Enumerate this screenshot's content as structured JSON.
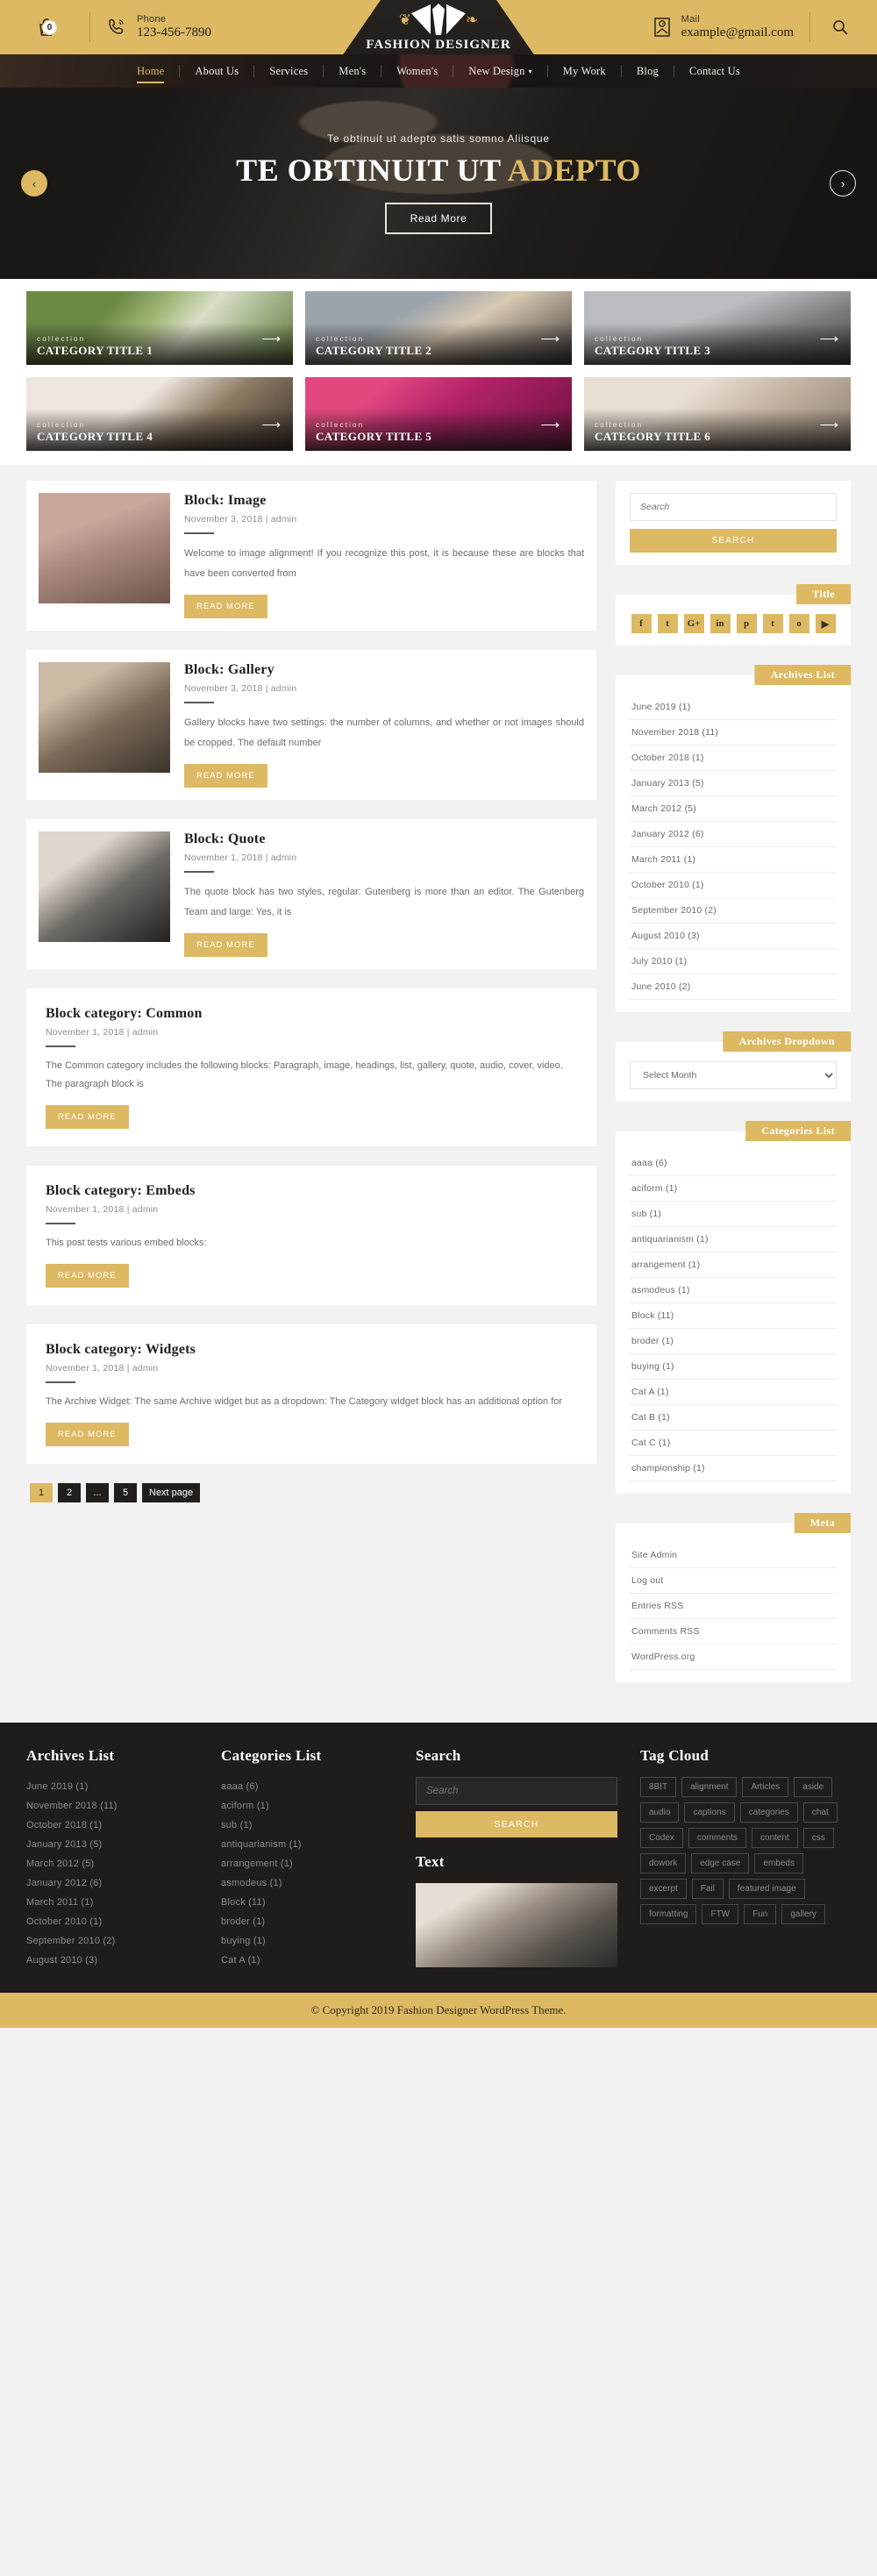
{
  "header": {
    "cart_count": "0",
    "phone_label": "Phone",
    "phone_value": "123-456-7890",
    "mail_label": "Mail",
    "mail_value": "example@gmail.com",
    "logo_text": "FASHION DESIGNER"
  },
  "nav": {
    "items": [
      {
        "label": "Home",
        "active": true,
        "dropdown": false
      },
      {
        "label": "About Us",
        "active": false,
        "dropdown": false
      },
      {
        "label": "Services",
        "active": false,
        "dropdown": false
      },
      {
        "label": "Men's",
        "active": false,
        "dropdown": false
      },
      {
        "label": "Women's",
        "active": false,
        "dropdown": false
      },
      {
        "label": "New Design",
        "active": false,
        "dropdown": true
      },
      {
        "label": "My Work",
        "active": false,
        "dropdown": false
      },
      {
        "label": "Blog",
        "active": false,
        "dropdown": false
      },
      {
        "label": "Contact Us",
        "active": false,
        "dropdown": false
      }
    ]
  },
  "hero": {
    "subtitle": "Te obtinuit ut adepto satis somno Aliisque",
    "title_white": "TE OBTINUIT UT ",
    "title_gold": "ADEPTO",
    "button": "Read More",
    "prev": "‹",
    "next": "›"
  },
  "categories": [
    {
      "kicker": "collection",
      "title": "CATEGORY TITLE 1"
    },
    {
      "kicker": "collection",
      "title": "CATEGORY TITLE 2"
    },
    {
      "kicker": "collection",
      "title": "CATEGORY TITLE 3"
    },
    {
      "kicker": "collection",
      "title": "CATEGORY TITLE 4"
    },
    {
      "kicker": "collection",
      "title": "CATEGORY TITLE 5"
    },
    {
      "kicker": "collection",
      "title": "CATEGORY TITLE 6"
    }
  ],
  "posts": [
    {
      "title": "Block: Image",
      "meta": "November 3, 2018 |  admin",
      "excerpt": "Welcome to image alignment! If you recognize this post, it is because these are blocks that have been converted from",
      "read_more": "READ MORE"
    },
    {
      "title": "Block: Gallery",
      "meta": "November 3, 2018 |  admin",
      "excerpt": "Gallery blocks have two settings: the number of columns, and whether or not images should be cropped. The default number",
      "read_more": "READ MORE"
    },
    {
      "title": "Block: Quote",
      "meta": "November 1, 2018 |  admin",
      "excerpt": "The quote block has two styles, regular: Gutenberg is more than an editor. The Gutenberg Team and large: Yes, it is",
      "read_more": "READ MORE"
    }
  ],
  "wide_posts": [
    {
      "title": "Block category: Common",
      "meta": "November 1, 2018 |  admin",
      "excerpt": "The Common category includes the following blocks: Paragraph, image, headings, list, gallery, quote, audio, cover, video. The paragraph block is",
      "read_more": "READ MORE"
    },
    {
      "title": "Block category: Embeds",
      "meta": "November 1, 2018 |  admin",
      "excerpt": "This post tests various embed blocks:",
      "read_more": "READ MORE"
    },
    {
      "title": "Block category: Widgets",
      "meta": "November 1, 2018 |  admin",
      "excerpt": "The Archive Widget: The same Archive widget but as a dropdown: The Category widget block has an additional option for",
      "read_more": "READ MORE"
    }
  ],
  "pagination": [
    {
      "label": "1",
      "active": true
    },
    {
      "label": "2",
      "active": false
    },
    {
      "label": "...",
      "active": false
    },
    {
      "label": "5",
      "active": false
    },
    {
      "label": "Next page",
      "active": false
    }
  ],
  "sidebar": {
    "search": {
      "placeholder": "Search",
      "button": "SEARCH"
    },
    "social": {
      "title": "Title",
      "items": [
        {
          "name": "facebook",
          "glyph": "f"
        },
        {
          "name": "twitter",
          "glyph": "t"
        },
        {
          "name": "google-plus",
          "glyph": "G+"
        },
        {
          "name": "linkedin",
          "glyph": "in"
        },
        {
          "name": "pinterest",
          "glyph": "p"
        },
        {
          "name": "tumblr",
          "glyph": "t"
        },
        {
          "name": "instagram",
          "glyph": "o"
        },
        {
          "name": "youtube",
          "glyph": "▶"
        }
      ]
    },
    "archives_list": {
      "title": "Archives List",
      "items": [
        "June 2019 (1)",
        "November 2018 (11)",
        "October 2018 (1)",
        "January 2013 (5)",
        "March 2012 (5)",
        "January 2012 (6)",
        "March 2011 (1)",
        "October 2010 (1)",
        "September 2010 (2)",
        "August 2010 (3)",
        "July 2010 (1)",
        "June 2010 (2)"
      ]
    },
    "archives_dropdown": {
      "title": "Archives Dropdown",
      "selected": "Select Month"
    },
    "categories_list": {
      "title": "Categories List",
      "items": [
        "aaaa (6)",
        "aciform (1)",
        "sub (1)",
        "antiquarianism (1)",
        "arrangement (1)",
        "asmodeus (1)",
        "Block (11)",
        "broder (1)",
        "buying (1)",
        "Cat A (1)",
        "Cat B (1)",
        "Cat C (1)",
        "championship (1)"
      ]
    },
    "meta": {
      "title": "Meta",
      "items": [
        "Site Admin",
        "Log out",
        "Entries RSS",
        "Comments RSS",
        "WordPress.org"
      ]
    }
  },
  "footer": {
    "archives": {
      "title": "Archives List",
      "items": [
        "June 2019 (1)",
        "November 2018 (11)",
        "October 2018 (1)",
        "January 2013 (5)",
        "March 2012 (5)",
        "January 2012 (6)",
        "March 2011 (1)",
        "October 2010 (1)",
        "September 2010 (2)",
        "August 2010 (3)"
      ]
    },
    "categories": {
      "title": "Categories List",
      "items": [
        "aaaa (6)",
        "aciform (1)",
        "sub (1)",
        "antiquarianism (1)",
        "arrangement (1)",
        "asmodeus (1)",
        "Block (11)",
        "broder (1)",
        "buying (1)",
        "Cat A (1)"
      ]
    },
    "search": {
      "title": "Search",
      "placeholder": "Search",
      "button": "SEARCH"
    },
    "text": {
      "title": "Text"
    },
    "tagcloud": {
      "title": "Tag Cloud",
      "tags": [
        "8BIT",
        "alignment",
        "Articles",
        "aside",
        "audio",
        "captions",
        "categories",
        "chat",
        "Codex",
        "comments",
        "content",
        "css",
        "dowork",
        "edge case",
        "embeds",
        "excerpt",
        "Fail",
        "featured image",
        "formatting",
        "FTW",
        "Fun",
        "gallery"
      ]
    },
    "copyright": "© Copyright 2019 Fashion Designer WordPress Theme."
  },
  "colors": {
    "gold": "#ddb963",
    "dark": "#1f1c1a"
  }
}
